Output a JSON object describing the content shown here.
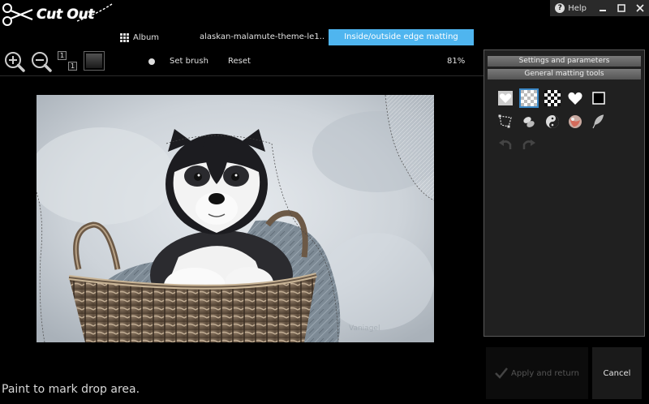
{
  "app": {
    "logo_text": "Cut Out"
  },
  "window_controls": {
    "help_label": "Help",
    "help_icon": "question-circle-icon"
  },
  "tabs": {
    "album_label": "Album",
    "file_label": "alaskan-malamute-theme-le1..",
    "active_label": "Inside/outside edge matting"
  },
  "toolbar": {
    "one_to_one": "1",
    "set_brush_label": "Set brush",
    "reset_label": "Reset",
    "zoom_level": "81%"
  },
  "canvas": {
    "watermark": "Vaniagel"
  },
  "panel": {
    "settings_title": "Settings and parameters",
    "tools_title": "General matting tools",
    "tools_row1": [
      "heart-frame-icon",
      "checker-small-icon",
      "checker-large-icon",
      "heart-icon",
      "square-icon"
    ],
    "tools_row2": [
      "polygon-lasso-icon",
      "smudge-icon",
      "contrast-icon",
      "color-ball-icon",
      "feather-icon"
    ],
    "tools_row3": [
      "undo-icon",
      "redo-icon"
    ]
  },
  "status_text": "Paint to mark drop area.",
  "buttons": {
    "apply_label": "Apply and return",
    "cancel_label": "Cancel"
  },
  "colors": {
    "accent": "#4fb5ef",
    "selected_tool": "#3c89c8",
    "background": "#000000",
    "panel": "#202020"
  }
}
